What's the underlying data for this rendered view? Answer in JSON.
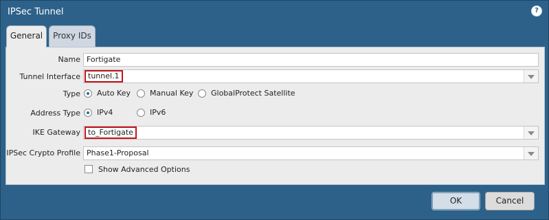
{
  "window": {
    "title": "IPSec Tunnel",
    "help_icon": "?"
  },
  "tabs": [
    {
      "label": "General",
      "active": true
    },
    {
      "label": "Proxy IDs",
      "active": false
    }
  ],
  "form": {
    "name": {
      "label": "Name",
      "value": "Fortigate"
    },
    "tunnel_interface": {
      "label": "Tunnel Interface",
      "value": "tunnel.1",
      "highlighted": true
    },
    "type": {
      "label": "Type",
      "options": [
        "Auto Key",
        "Manual Key",
        "GlobalProtect Satellite"
      ],
      "selected": "Auto Key"
    },
    "address_type": {
      "label": "Address Type",
      "options": [
        "IPv4",
        "IPv6"
      ],
      "selected": "IPv4"
    },
    "ike_gateway": {
      "label": "IKE Gateway",
      "value": "to_Fortigate",
      "highlighted": true
    },
    "ipsec_crypto_profile": {
      "label": "IPSec Crypto Profile",
      "value": "Phase1-Proposal"
    },
    "show_advanced": {
      "label": "Show Advanced Options",
      "checked": false
    }
  },
  "buttons": {
    "ok": "OK",
    "cancel": "Cancel"
  },
  "colors": {
    "dialog_background": "#2d6189",
    "highlight_border": "#c0141a",
    "panel_background": "#ececec"
  }
}
